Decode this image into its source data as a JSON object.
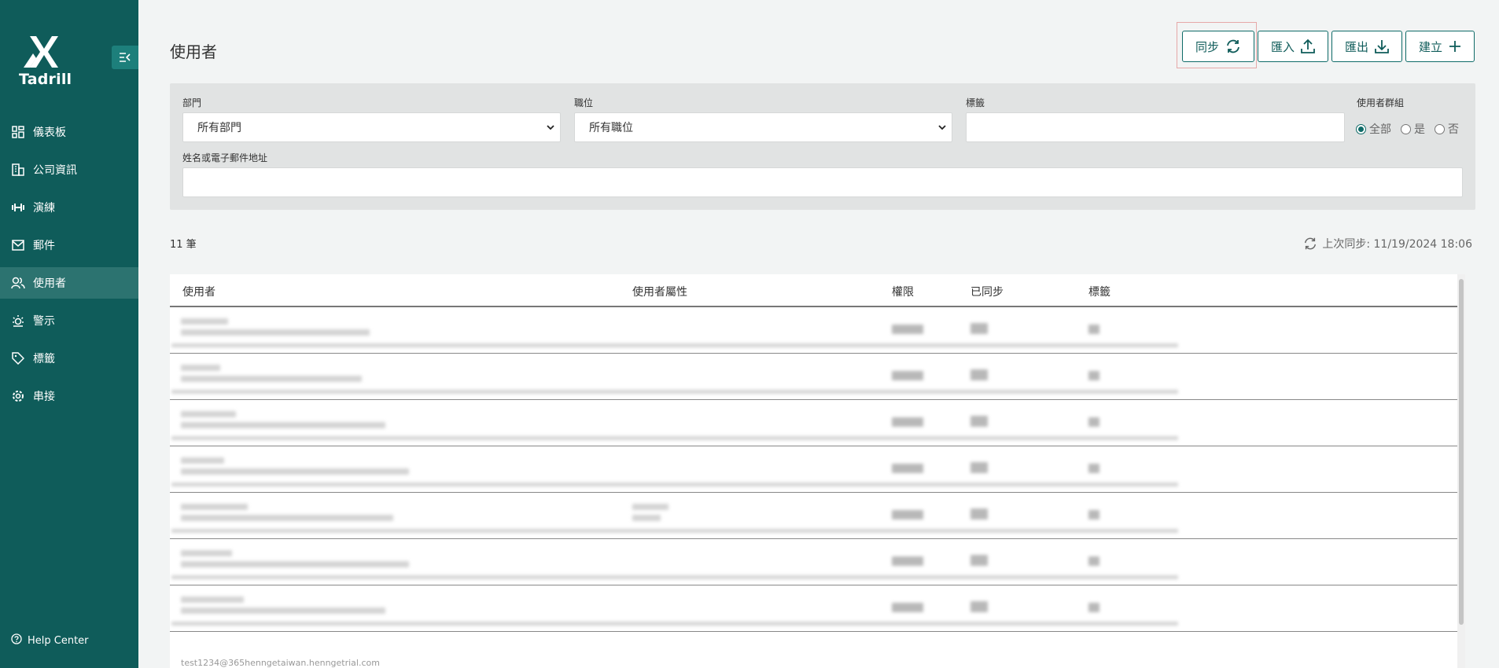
{
  "sidebar": {
    "brand": "Tadrill",
    "items": [
      {
        "label": "儀表板",
        "icon": "dashboard-icon"
      },
      {
        "label": "公司資訊",
        "icon": "building-icon"
      },
      {
        "label": "演練",
        "icon": "dumbbell-icon"
      },
      {
        "label": "郵件",
        "icon": "mail-icon"
      },
      {
        "label": "使用者",
        "icon": "users-icon",
        "active": true
      },
      {
        "label": "警示",
        "icon": "alert-icon"
      },
      {
        "label": "標籤",
        "icon": "tag-icon"
      },
      {
        "label": "串接",
        "icon": "gear-icon"
      }
    ],
    "help": "Help Center"
  },
  "header": {
    "title": "使用者",
    "buttons": {
      "sync": "同步",
      "import": "匯入",
      "export": "匯出",
      "create": "建立"
    }
  },
  "filters": {
    "department_label": "部門",
    "department_value": "所有部門",
    "position_label": "職位",
    "position_value": "所有職位",
    "tag_label": "標籤",
    "group_label": "使用者群組",
    "group_options": [
      "全部",
      "是",
      "否"
    ],
    "group_selected": "全部",
    "name_label": "姓名或電子郵件地址"
  },
  "summary": {
    "count": "11 筆",
    "last_sync": "上次同步: 11/19/2024 18:06"
  },
  "table": {
    "columns": [
      "使用者",
      "使用者屬性",
      "權限",
      "已同步",
      "標籤"
    ],
    "visible_email": "test1234@365henngetaiwan.henngetrial.com"
  },
  "colors": {
    "sidebar": "#0f5c5a",
    "accent": "#0f6b68",
    "active": "#2c7370"
  }
}
